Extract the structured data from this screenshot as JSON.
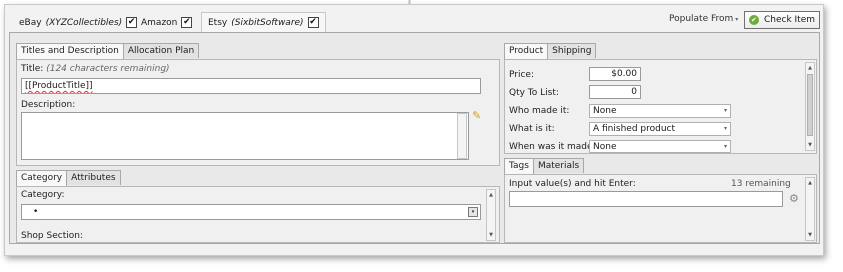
{
  "marketplaces": [
    {
      "label": "eBay",
      "account": "(XYZCollectibles)",
      "checked": true
    },
    {
      "label": "Amazon",
      "checked": true
    },
    {
      "label": "Etsy",
      "account": "(SixbitSoftware)",
      "checked": true
    }
  ],
  "toolbar": {
    "populate_from": "Populate From",
    "check_item": "Check Item"
  },
  "titles_panel": {
    "tabs": [
      "Titles and Description",
      "Allocation Plan"
    ],
    "title_label": "Title:",
    "title_hint": "(124 characters remaining)",
    "title_value": "[[ProductTitle]]",
    "description_label": "Description:"
  },
  "category_panel": {
    "tabs": [
      "Category",
      "Attributes"
    ],
    "category_label": "Category:",
    "category_value": "•",
    "shop_section_label": "Shop Section:"
  },
  "product_panel": {
    "tabs": [
      "Product",
      "Shipping"
    ],
    "price_label": "Price:",
    "price_value": "$0.00",
    "qty_label": "Qty To List:",
    "qty_value": "0",
    "who_made_label": "Who made it:",
    "who_made_value": "None",
    "what_is_label": "What is it:",
    "what_is_value": "A finished product",
    "when_made_label": "When was it made:",
    "when_made_value": "None"
  },
  "tags_panel": {
    "tabs": [
      "Tags",
      "Materials"
    ],
    "input_label": "Input value(s) and hit Enter:",
    "remaining": "13 remaining"
  },
  "icons": {
    "check": "✔",
    "ok": "✔",
    "caret": "▾",
    "pencil": "✎",
    "gear": "⚙"
  }
}
